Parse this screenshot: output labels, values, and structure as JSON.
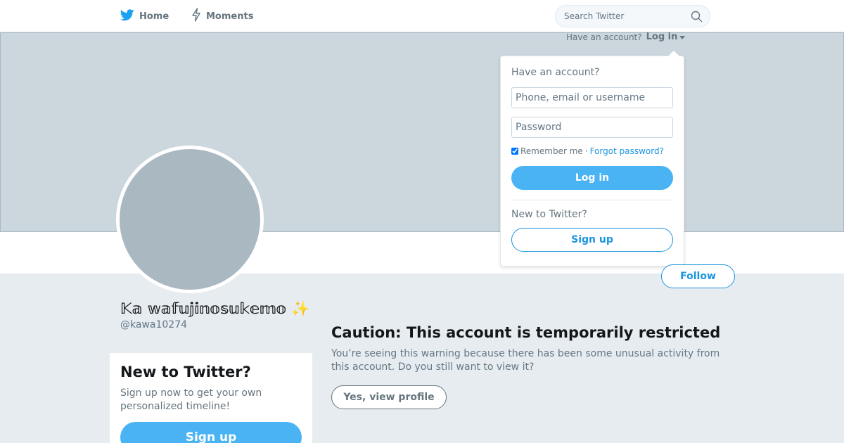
{
  "nav": {
    "home_label": "Home",
    "moments_label": "Moments",
    "search_placeholder": "Search Twitter"
  },
  "login_prompt": {
    "text": "Have an account?",
    "toggle_label": "Log in"
  },
  "login_dropdown": {
    "title": "Have an account?",
    "username_placeholder": "Phone, email or username",
    "password_placeholder": "Password",
    "remember_label": "Remember me",
    "separator": "·",
    "forgot_label": "Forgot password?",
    "login_button": "Log in",
    "new_label": "New to Twitter?",
    "signup_button": "Sign up"
  },
  "profile": {
    "display_name": "𝕂𝕒 𝕨𝕒𝕗𝕦𝕛𝕚𝕟𝕠𝕤𝕦𝕜𝕖𝕞𝕠 ✨",
    "handle": "@kawa10274",
    "follow_button": "Follow"
  },
  "signup_card": {
    "title": "New to Twitter?",
    "subtitle": "Sign up now to get your own personalized timeline!",
    "button": "Sign up"
  },
  "caution": {
    "title": "Caution: This account is temporarily restricted",
    "body": "You’re seeing this warning because there has been some unusual activity from this account. Do you still want to view it?",
    "button": "Yes, view profile"
  },
  "colors": {
    "brand_blue": "#1da1f2",
    "button_blue": "#4ab3f4",
    "link_blue": "#1b95e0",
    "banner": "#ccd6dd",
    "avatar": "#aab8c2",
    "page_bg": "#e6ecf0"
  },
  "icons": {
    "home": "twitter-bird-icon",
    "moments": "lightning-icon",
    "search": "search-icon",
    "login_caret": "caret-down-icon"
  }
}
